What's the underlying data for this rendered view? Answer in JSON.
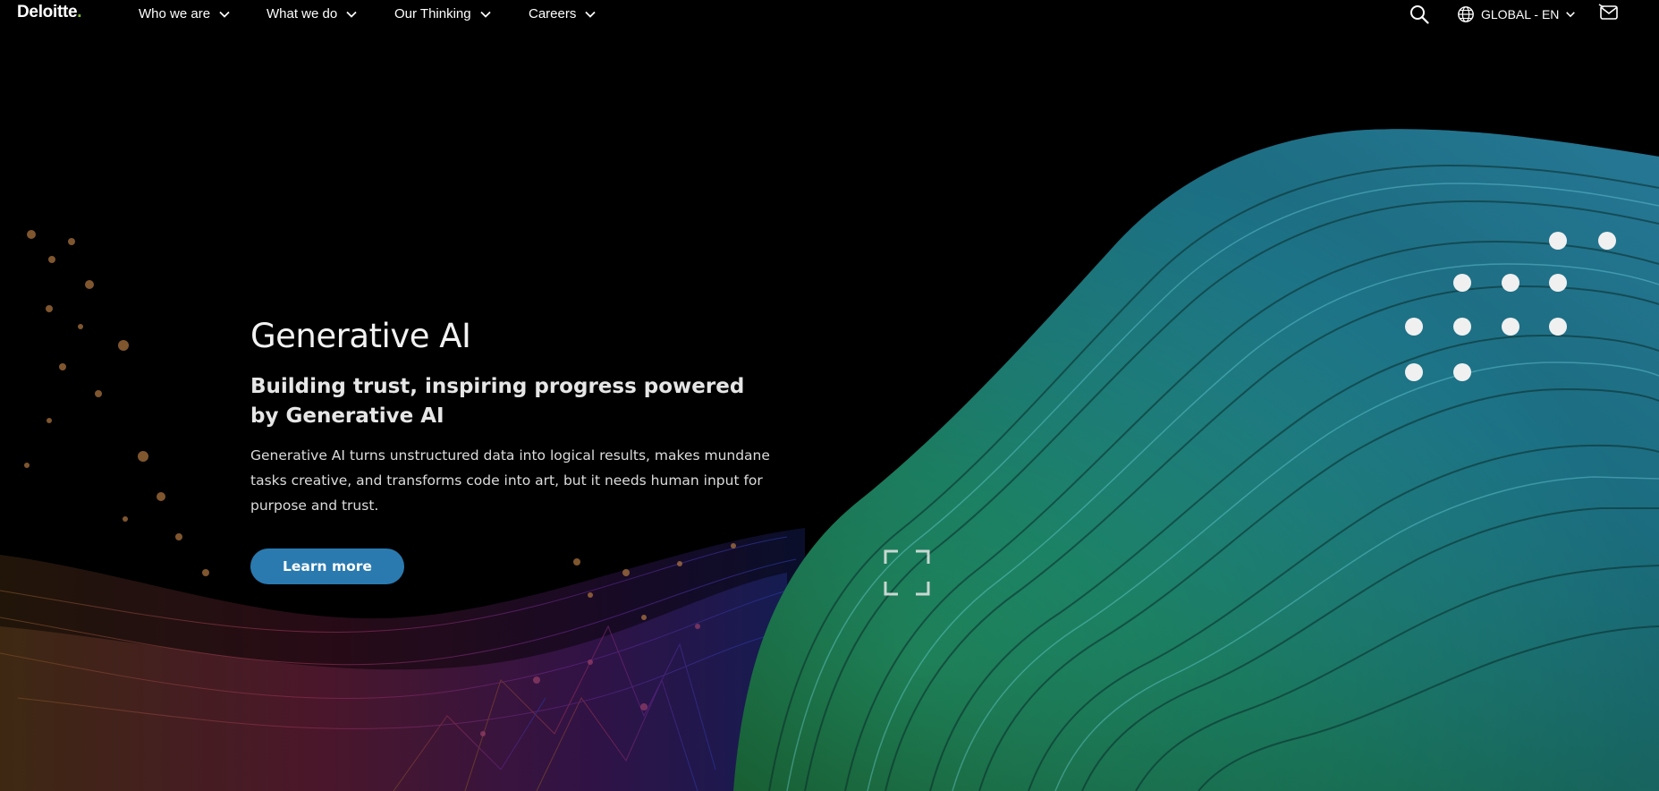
{
  "brand": {
    "name": "Deloitte",
    "dot": ".",
    "accent_color": "#86bc25"
  },
  "nav": {
    "items": [
      {
        "label": "Who we are"
      },
      {
        "label": "What we do"
      },
      {
        "label": "Our Thinking"
      },
      {
        "label": "Careers"
      }
    ],
    "search_icon": "search-icon",
    "language_label": "GLOBAL - EN",
    "globe_icon": "globe-icon",
    "contact_icon": "contact-mail-icon"
  },
  "hero": {
    "title": "Generative AI",
    "subtitle": "Building trust, inspiring progress powered by Generative AI",
    "body": "Generative AI turns unstructured data into logical results, makes mundane tasks creative, and transforms code into art, but it needs human input for purpose and trust.",
    "cta_label": "Learn more",
    "cta_color": "#2a7ab0",
    "expand_icon": "expand-fullscreen-icon"
  }
}
